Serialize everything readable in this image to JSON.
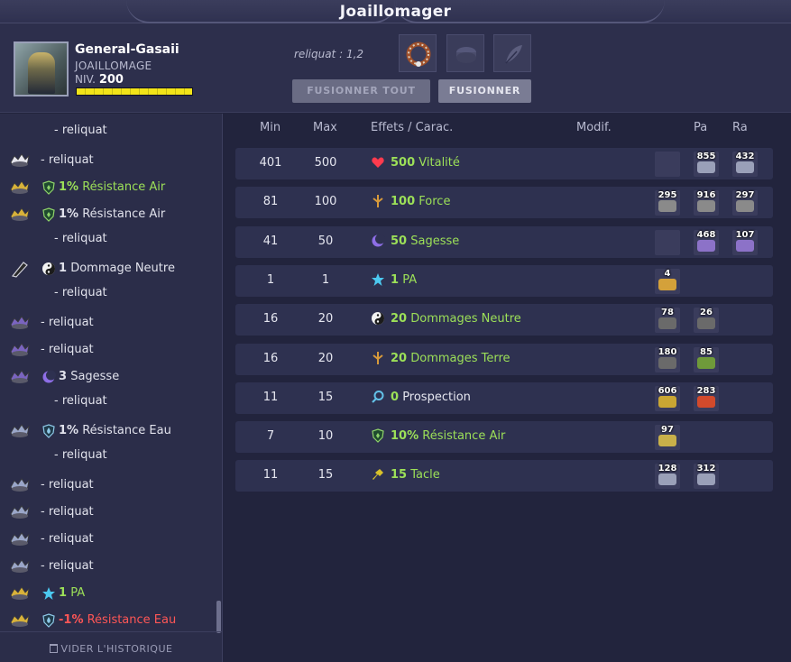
{
  "window": {
    "title": "Joaillomager"
  },
  "character": {
    "name": "General-Gasaii",
    "job": "JOAILLOMAGE",
    "level_label": "NIV.",
    "level": "200",
    "xp_progress": 1.0
  },
  "header": {
    "reliquat": "reliquat : 1,2",
    "slots": [
      "item-ring-icon",
      "smithmagic-rune-icon",
      "feather-icon"
    ]
  },
  "buttons": {
    "merge_all": "FUSIONNER TOUT",
    "merge": "FUSIONNER"
  },
  "history": {
    "clear_label": "VIDER L'HISTORIQUE",
    "items": [
      {
        "icon": "none",
        "value": "",
        "label": "- reliquat",
        "indent": true,
        "color": "white"
      },
      {
        "icon": "rune-vitality-icon",
        "value": "",
        "label": "- reliquat",
        "indent": false,
        "color": "white"
      },
      {
        "icon": "rune-gold-icon",
        "effect_icon": "shield-air-icon",
        "value": "1%",
        "label": "Résistance Air",
        "color": "green"
      },
      {
        "icon": "rune-gold-icon",
        "effect_icon": "shield-air-icon",
        "value": "1%",
        "label": "Résistance Air",
        "color": "white"
      },
      {
        "icon": "none",
        "value": "",
        "label": "- reliquat",
        "indent": true,
        "color": "white"
      },
      {
        "icon": "rune-dark-icon",
        "effect_icon": "yin-yang-icon",
        "value": "1",
        "label": "Dommage Neutre",
        "color": "white"
      },
      {
        "icon": "none",
        "value": "",
        "label": "- reliquat",
        "indent": true,
        "color": "white"
      },
      {
        "icon": "rune-purple-icon",
        "value": "",
        "label": "- reliquat",
        "color": "white"
      },
      {
        "icon": "rune-purple-icon",
        "value": "",
        "label": "- reliquat",
        "color": "white"
      },
      {
        "icon": "rune-purple-icon",
        "effect_icon": "moon-icon",
        "value": "3",
        "label": "Sagesse",
        "color": "white"
      },
      {
        "icon": "none",
        "value": "",
        "label": "- reliquat",
        "indent": true,
        "color": "white"
      },
      {
        "icon": "rune-blue-icon",
        "effect_icon": "shield-water-icon",
        "value": "1%",
        "label": "Résistance Eau",
        "color": "white"
      },
      {
        "icon": "none",
        "value": "",
        "label": "- reliquat",
        "indent": true,
        "color": "white"
      },
      {
        "icon": "rune-blue-icon",
        "value": "",
        "label": "- reliquat",
        "color": "white"
      },
      {
        "icon": "rune-blue-icon",
        "value": "",
        "label": "- reliquat",
        "color": "white"
      },
      {
        "icon": "rune-blue-icon",
        "value": "",
        "label": "- reliquat",
        "color": "white"
      },
      {
        "icon": "rune-blue-icon",
        "value": "",
        "label": "- reliquat",
        "color": "white"
      },
      {
        "icon": "rune-gold-icon",
        "effect_icon": "star-icon",
        "value": "1",
        "label": "PA",
        "color": "green"
      },
      {
        "icon": "rune-gold-icon",
        "effect_icon": "shield-water-icon",
        "value": "-1%",
        "label": "Résistance Eau",
        "color": "red"
      }
    ]
  },
  "table": {
    "headers": {
      "min": "Min",
      "max": "Max",
      "effects": "Effets / Carac.",
      "modif": "Modif.",
      "pa": "Pa",
      "ra": "Ra"
    },
    "rows": [
      {
        "min": "401",
        "max": "500",
        "effect_icon": "heart-icon",
        "value": "500",
        "label": "Vitalité",
        "runes": [
          "",
          "855",
          "432"
        ],
        "rune_colors": [
          "",
          "#9aa0b8",
          "#9aa0b8"
        ]
      },
      {
        "min": "81",
        "max": "100",
        "effect_icon": "earth-sprout-icon",
        "value": "100",
        "label": "Force",
        "runes": [
          "295",
          "916",
          "297"
        ],
        "rune_colors": [
          "#8a8a8a",
          "#8a8a8a",
          "#8a8a8a"
        ]
      },
      {
        "min": "41",
        "max": "50",
        "effect_icon": "moon-icon",
        "value": "50",
        "label": "Sagesse",
        "runes": [
          "",
          "468",
          "107"
        ],
        "rune_colors": [
          "",
          "#8c72c8",
          "#8c72c8"
        ]
      },
      {
        "min": "1",
        "max": "1",
        "effect_icon": "star-icon",
        "value": "1",
        "label": "PA",
        "runes": [
          "4"
        ],
        "rune_colors": [
          "#d4a13a"
        ]
      },
      {
        "min": "16",
        "max": "20",
        "effect_icon": "yin-yang-icon",
        "value": "20",
        "label": "Dommages Neutre",
        "runes": [
          "78",
          "26"
        ],
        "rune_colors": [
          "#6a6a6a",
          "#6a6a6a"
        ]
      },
      {
        "min": "16",
        "max": "20",
        "effect_icon": "earth-sprout-icon",
        "value": "20",
        "label": "Dommages Terre",
        "runes": [
          "180",
          "85"
        ],
        "rune_colors": [
          "#6a6a6a",
          "#6f9a3a"
        ]
      },
      {
        "min": "11",
        "max": "15",
        "effect_icon": "magnifier-icon",
        "value": "0",
        "label": "Prospection",
        "runes": [
          "606",
          "283"
        ],
        "rune_colors": [
          "#c9a633",
          "#d24a2c"
        ]
      },
      {
        "min": "7",
        "max": "10",
        "effect_icon": "shield-air-icon",
        "value": "10%",
        "label": "Résistance Air",
        "runes": [
          "97"
        ],
        "rune_colors": [
          "#c9b04a"
        ]
      },
      {
        "min": "11",
        "max": "15",
        "effect_icon": "tackle-icon",
        "value": "15",
        "label": "Tacle",
        "runes": [
          "128",
          "312"
        ],
        "rune_colors": [
          "#9aa0b8",
          "#9aa0b8"
        ]
      }
    ]
  },
  "colors": {
    "green": "#9ce058",
    "red": "#ff5656",
    "panel": "#2e3150",
    "background": "#22243d"
  }
}
